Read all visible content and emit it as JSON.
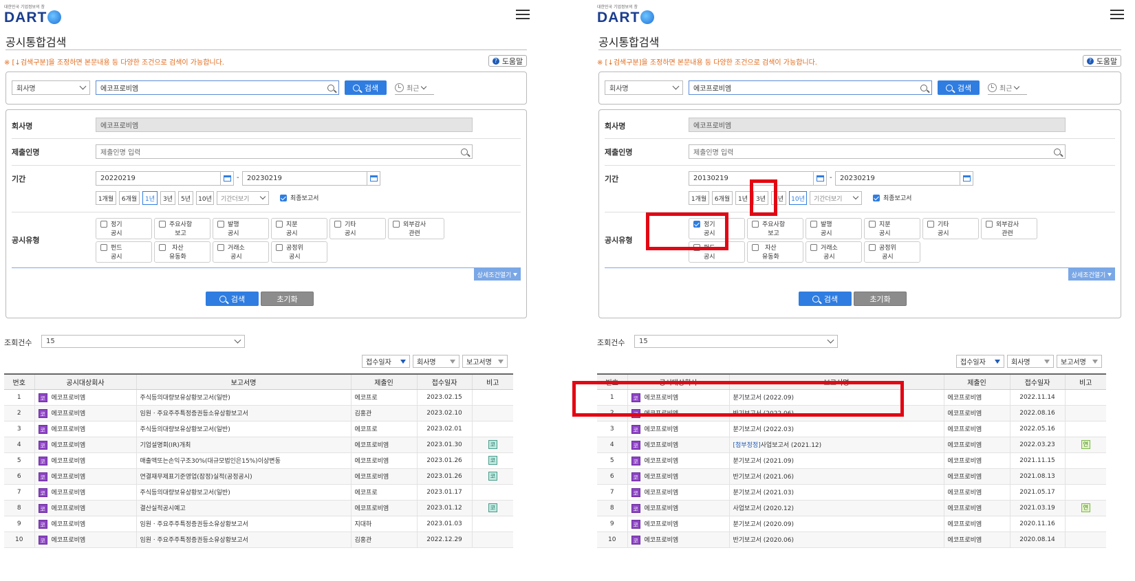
{
  "logo": {
    "tagline": "대한민국 기업정보의 창",
    "name": "DART"
  },
  "page_title": "공시통합검색",
  "notice": "※ [↓검색구분]을 조정하면 본문내용 등 다양한 조건으로 검색이 가능합니다.",
  "help_label": "도움말",
  "search": {
    "type": "회사명",
    "query": "에코프로비엠",
    "button": "검색",
    "recent": "최근"
  },
  "form": {
    "company_label": "회사명",
    "company_value": "에코프로비엠",
    "submitter_label": "제출인명",
    "submitter_placeholder": "제출인명 입력",
    "period_label": "기간",
    "dash": "-",
    "period_buttons": [
      "1개월",
      "6개월",
      "1년",
      "3년",
      "5년",
      "10년"
    ],
    "period_more": "기간더보기",
    "final_report": "최종보고서",
    "type_label": "공시유형",
    "types": [
      {
        "l1": "정기",
        "l2": "공시"
      },
      {
        "l1": "주요사항",
        "l2": "보고"
      },
      {
        "l1": "발행",
        "l2": "공시"
      },
      {
        "l1": "지분",
        "l2": "공시"
      },
      {
        "l1": "기타",
        "l2": "공시"
      },
      {
        "l1": "외부감사",
        "l2": "관련"
      },
      {
        "l1": "펀드",
        "l2": "공시"
      },
      {
        "l1": "자산",
        "l2": "유동화"
      },
      {
        "l1": "거래소",
        "l2": "공시"
      },
      {
        "l1": "공정위",
        "l2": "공시"
      }
    ],
    "advanced": "상세조건열기",
    "search_button": "검색",
    "reset_button": "초기화"
  },
  "results": {
    "count_label": "조회건수",
    "count_value": "15",
    "sorts": [
      "접수일자",
      "회사명",
      "보고서명"
    ],
    "columns": [
      "번호",
      "공시대상회사",
      "보고서명",
      "제출인",
      "접수일자",
      "비고"
    ],
    "corp_badge": "코"
  },
  "left": {
    "start_date": "20220219",
    "end_date": "20230219",
    "active_period": "1년",
    "checked_types": [],
    "rows": [
      {
        "no": "1",
        "corp": "에코프로비엠",
        "report": "주식등의대량보유상황보고서(일반)",
        "submitter": "에코프로",
        "date": "2023.02.15",
        "note": ""
      },
      {
        "no": "2",
        "corp": "에코프로비엠",
        "report": "임원ㆍ주요주주특정증권등소유상황보고서",
        "submitter": "김홍관",
        "date": "2023.02.10",
        "note": ""
      },
      {
        "no": "3",
        "corp": "에코프로비엠",
        "report": "주식등의대량보유상황보고서(일반)",
        "submitter": "에코프로",
        "date": "2023.02.01",
        "note": ""
      },
      {
        "no": "4",
        "corp": "에코프로비엠",
        "report": "기업설명회(IR)개최",
        "submitter": "에코프로비엠",
        "date": "2023.01.30",
        "note": "코"
      },
      {
        "no": "5",
        "corp": "에코프로비엠",
        "report": "매출액또는손익구조30%(대규모법인은15%)이상변동",
        "submitter": "에코프로비엠",
        "date": "2023.01.26",
        "note": "코"
      },
      {
        "no": "6",
        "corp": "에코프로비엠",
        "report": "연결재무제표기준영업(잠정)실적(공정공시)",
        "submitter": "에코프로비엠",
        "date": "2023.01.26",
        "note": "코"
      },
      {
        "no": "7",
        "corp": "에코프로비엠",
        "report": "주식등의대량보유상황보고서(일반)",
        "submitter": "에코프로",
        "date": "2023.01.17",
        "note": ""
      },
      {
        "no": "8",
        "corp": "에코프로비엠",
        "report": "결산실적공시예고",
        "submitter": "에코프로비엠",
        "date": "2023.01.12",
        "note": "코"
      },
      {
        "no": "9",
        "corp": "에코프로비엠",
        "report": "임원ㆍ주요주주특정증권등소유상황보고서",
        "submitter": "지대하",
        "date": "2023.01.03",
        "note": ""
      },
      {
        "no": "10",
        "corp": "에코프로비엠",
        "report": "임원ㆍ주요주주특정증권등소유상황보고서",
        "submitter": "김홍관",
        "date": "2022.12.29",
        "note": ""
      }
    ]
  },
  "right": {
    "start_date": "20130219",
    "end_date": "20230219",
    "active_period": "10년",
    "checked_types": [
      "정기"
    ],
    "rows": [
      {
        "no": "1",
        "corp": "에코프로비엠",
        "report": "분기보고서 (2022.09)",
        "submitter": "에코프로비엠",
        "date": "2022.11.14",
        "note": ""
      },
      {
        "no": "2",
        "corp": "에코프로비엠",
        "report": "반기보고서 (2022.06)",
        "submitter": "에코프로비엠",
        "date": "2022.08.16",
        "note": ""
      },
      {
        "no": "3",
        "corp": "에코프로비엠",
        "report": "분기보고서 (2022.03)",
        "submitter": "에코프로비엠",
        "date": "2022.05.16",
        "note": ""
      },
      {
        "no": "4",
        "corp": "에코프로비엠",
        "report_prefix": "[첨부정정]",
        "report": "사업보고서 (2021.12)",
        "submitter": "에코프로비엠",
        "date": "2022.03.23",
        "note": "연"
      },
      {
        "no": "5",
        "corp": "에코프로비엠",
        "report": "분기보고서 (2021.09)",
        "submitter": "에코프로비엠",
        "date": "2021.11.15",
        "note": ""
      },
      {
        "no": "6",
        "corp": "에코프로비엠",
        "report": "반기보고서 (2021.06)",
        "submitter": "에코프로비엠",
        "date": "2021.08.13",
        "note": ""
      },
      {
        "no": "7",
        "corp": "에코프로비엠",
        "report": "분기보고서 (2021.03)",
        "submitter": "에코프로비엠",
        "date": "2021.05.17",
        "note": ""
      },
      {
        "no": "8",
        "corp": "에코프로비엠",
        "report": "사업보고서 (2020.12)",
        "submitter": "에코프로비엠",
        "date": "2021.03.19",
        "note": "연"
      },
      {
        "no": "9",
        "corp": "에코프로비엠",
        "report": "분기보고서 (2020.09)",
        "submitter": "에코프로비엠",
        "date": "2020.11.16",
        "note": ""
      },
      {
        "no": "10",
        "corp": "에코프로비엠",
        "report": "반기보고서 (2020.06)",
        "submitter": "에코프로비엠",
        "date": "2020.08.14",
        "note": ""
      }
    ]
  },
  "colors": {
    "accent": "#2f7de1",
    "annotation": "#e30613",
    "corp_badge": "#8e44c4"
  }
}
